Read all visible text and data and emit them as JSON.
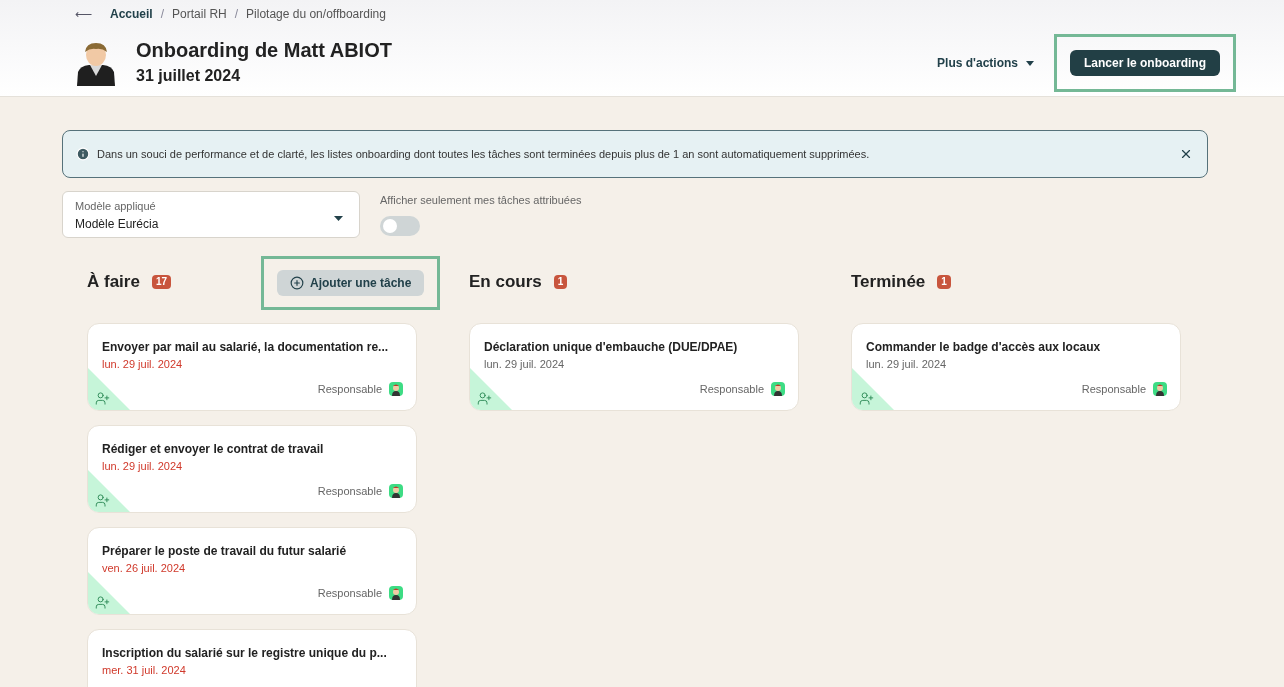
{
  "breadcrumb": {
    "back": "⟵",
    "separator": "/",
    "items": [
      {
        "label": "Accueil",
        "current": false
      },
      {
        "label": "Portail RH",
        "current": true
      },
      {
        "label": "Pilotage du on/offboarding",
        "current": true
      }
    ]
  },
  "header": {
    "title": "Onboarding de Matt ABIOT",
    "date": "31 juillet 2024",
    "more_actions": "Plus d'actions",
    "primary_button": {
      "label": "Lancer le onboarding",
      "highlighted": true
    }
  },
  "alert": {
    "text": "Dans un souci de performance et de clarté, les listes onboarding dont toutes les tâches sont terminées depuis plus de 1 an sont automatiquement supprimées."
  },
  "template_select": {
    "label": "Modèle appliqué",
    "value": "Modèle Eurécia"
  },
  "filter_toggle": {
    "label": "Afficher seulement mes tâches attribuées",
    "on": false
  },
  "add_task_button": {
    "label": "Ajouter une tâche",
    "highlighted": true
  },
  "columns": [
    {
      "title": "À faire",
      "count": "17",
      "cards": [
        {
          "title": "Envoyer par mail au salarié, la documentation re...",
          "date": "lun. 29 juil. 2024",
          "overdue": true,
          "assignee": "Responsable"
        },
        {
          "title": "Rédiger et envoyer le contrat de travail",
          "date": "lun. 29 juil. 2024",
          "overdue": true,
          "assignee": "Responsable"
        },
        {
          "title": "Préparer le poste de travail du futur salarié",
          "date": "ven. 26 juil. 2024",
          "overdue": true,
          "assignee": "Responsable"
        },
        {
          "title": "Inscription du salarié sur le registre unique du p...",
          "date": "mer. 31 juil. 2024",
          "overdue": true
        }
      ]
    },
    {
      "title": "En cours",
      "count": "1",
      "cards": [
        {
          "title": "Déclaration unique d'embauche (DUE/DPAE)",
          "date": "lun. 29 juil. 2024",
          "overdue": false,
          "assignee": "Responsable"
        }
      ]
    },
    {
      "title": "Terminée",
      "count": "1",
      "cards": [
        {
          "title": "Commander le badge d'accès aux locaux",
          "date": "lun. 29 juil. 2024",
          "overdue": false,
          "assignee": "Responsable"
        }
      ]
    }
  ]
}
